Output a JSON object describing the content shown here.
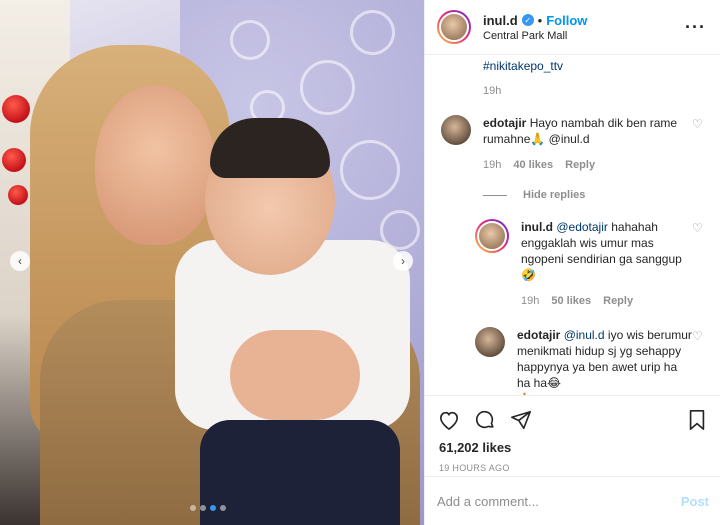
{
  "post": {
    "username": "inul.d",
    "verified_icon": "verified-badge-icon",
    "follow_label": "Follow",
    "separator": "•",
    "location": "Central Park Mall",
    "more_label": "···"
  },
  "caption": {
    "hashtag": "#nikitakepo_ttv",
    "time": "19h"
  },
  "comments": [
    {
      "user": "edotajir",
      "text": "Hayo nambah dik ben rame rumahne🙏 @inul.d",
      "time": "19h",
      "likes": "40 likes",
      "reply_label": "Reply"
    }
  ],
  "hide_replies_label": "Hide replies",
  "replies": [
    {
      "user": "inul.d",
      "mention": "@edotajir",
      "text": "hahahah enggaklah wis umur mas ngopeni sendirian ga sanggup🤣",
      "time": "19h",
      "likes": "50 likes",
      "reply_label": "Reply"
    },
    {
      "user": "edotajir",
      "mention": "@inul.d",
      "text": "iyo wis berumur menikmati hidup sj yg sehappy happynya ya ben awet urip ha ha ha😂",
      "extra": "🙏"
    }
  ],
  "actions": {
    "likes": "61,202 likes",
    "posted_time": "19 HOURS AGO"
  },
  "comment_box": {
    "placeholder": "Add a comment...",
    "post_label": "Post"
  },
  "colors": {
    "link_blue": "#0095f6",
    "mention_blue": "#00376b",
    "muted": "#8e8e8e"
  }
}
